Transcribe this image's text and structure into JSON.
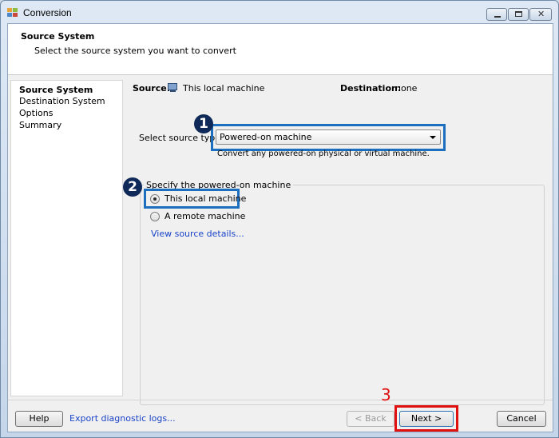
{
  "window": {
    "title": "Conversion",
    "minimize_label": "",
    "close_glyph": "✕"
  },
  "header": {
    "title": "Source System",
    "subtitle": "Select the source system you want to convert"
  },
  "steps": [
    {
      "label": "Source System",
      "active": true
    },
    {
      "label": "Destination System",
      "active": false
    },
    {
      "label": "Options",
      "active": false
    },
    {
      "label": "Summary",
      "active": false
    }
  ],
  "summary": {
    "source_label": "Source:",
    "source_value": "This local machine",
    "destination_label": "Destination:",
    "destination_value": "none"
  },
  "source_type": {
    "label": "Select source type:",
    "selected": "Powered-on machine",
    "description": "Convert any powered-on physical or virtual machine."
  },
  "machine_group": {
    "title": "Specify the powered-on machine",
    "options": [
      {
        "label": "This local machine",
        "selected": true
      },
      {
        "label": "A remote machine",
        "selected": false
      }
    ],
    "details_link": "View source details..."
  },
  "footer": {
    "help_label": "Help",
    "export_link": "Export diagnostic logs...",
    "back_label": "< Back",
    "next_label": "Next >",
    "cancel_label": "Cancel"
  },
  "annotations": {
    "badge_1": "1",
    "badge_2": "2",
    "step_3": "3"
  },
  "colors": {
    "highlight_blue": "#1c6fbf",
    "highlight_red": "#e01010",
    "link": "#1a43c8",
    "badge_fill": "#0f2a58"
  },
  "icons": {
    "app": "vmware-converter-icon",
    "source": "computer-monitor-icon"
  }
}
